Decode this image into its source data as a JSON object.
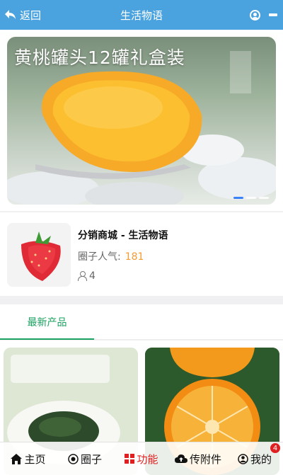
{
  "header": {
    "back_label": "返回",
    "title": "生活物语"
  },
  "banner": {
    "caption": "黄桃罐头12罐礼盒装"
  },
  "shop": {
    "name": "分销商城 - 生活物语",
    "popularity_label": "圈子人气:",
    "popularity_value": "181",
    "member_count": "4"
  },
  "tabs": [
    {
      "label": "最新产品"
    }
  ],
  "bottom_nav": [
    {
      "label": "主页",
      "icon": "home-icon"
    },
    {
      "label": "圈子",
      "icon": "circle-target-icon"
    },
    {
      "label": "功能",
      "icon": "grid-icon"
    },
    {
      "label": "传附件",
      "icon": "cloud-upload-icon"
    },
    {
      "label": "我的",
      "icon": "user-icon",
      "badge": "4"
    }
  ],
  "colors": {
    "header_bg": "#4aa3df",
    "accent_green": "#1aa260",
    "accent_red": "#e02020",
    "popularity_orange": "#f39c34"
  }
}
